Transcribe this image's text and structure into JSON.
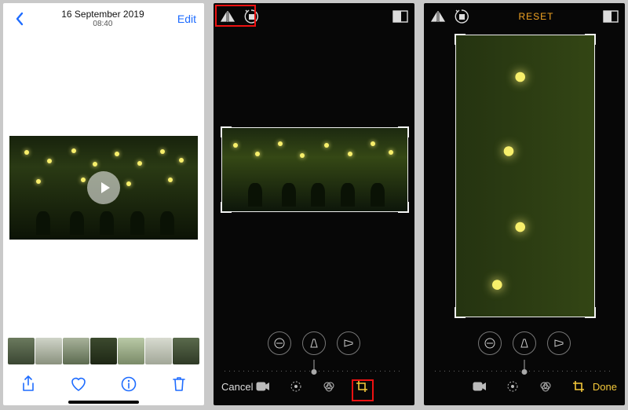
{
  "screen1": {
    "date": "16 September 2019",
    "time": "08:40",
    "edit": "Edit"
  },
  "screen3": {
    "reset": "RESET"
  },
  "editor": {
    "cancel": "Cancel",
    "done": "Done"
  },
  "icons": {
    "back": "chevron-left",
    "share": "share",
    "heart": "heart",
    "info": "info",
    "trash": "trash",
    "flipH": "flip-horizontal",
    "rotate": "rotate",
    "aspect": "aspect-ratio",
    "straighten": "straighten",
    "flipV": "flip-vertical",
    "perspV": "perspective-vertical",
    "video": "video",
    "adjust": "adjust",
    "filters": "filters",
    "crop": "crop"
  },
  "highlights": {
    "screen2_top": "flip-and-rotate-tools",
    "screen2_bottom": "crop-tab"
  }
}
